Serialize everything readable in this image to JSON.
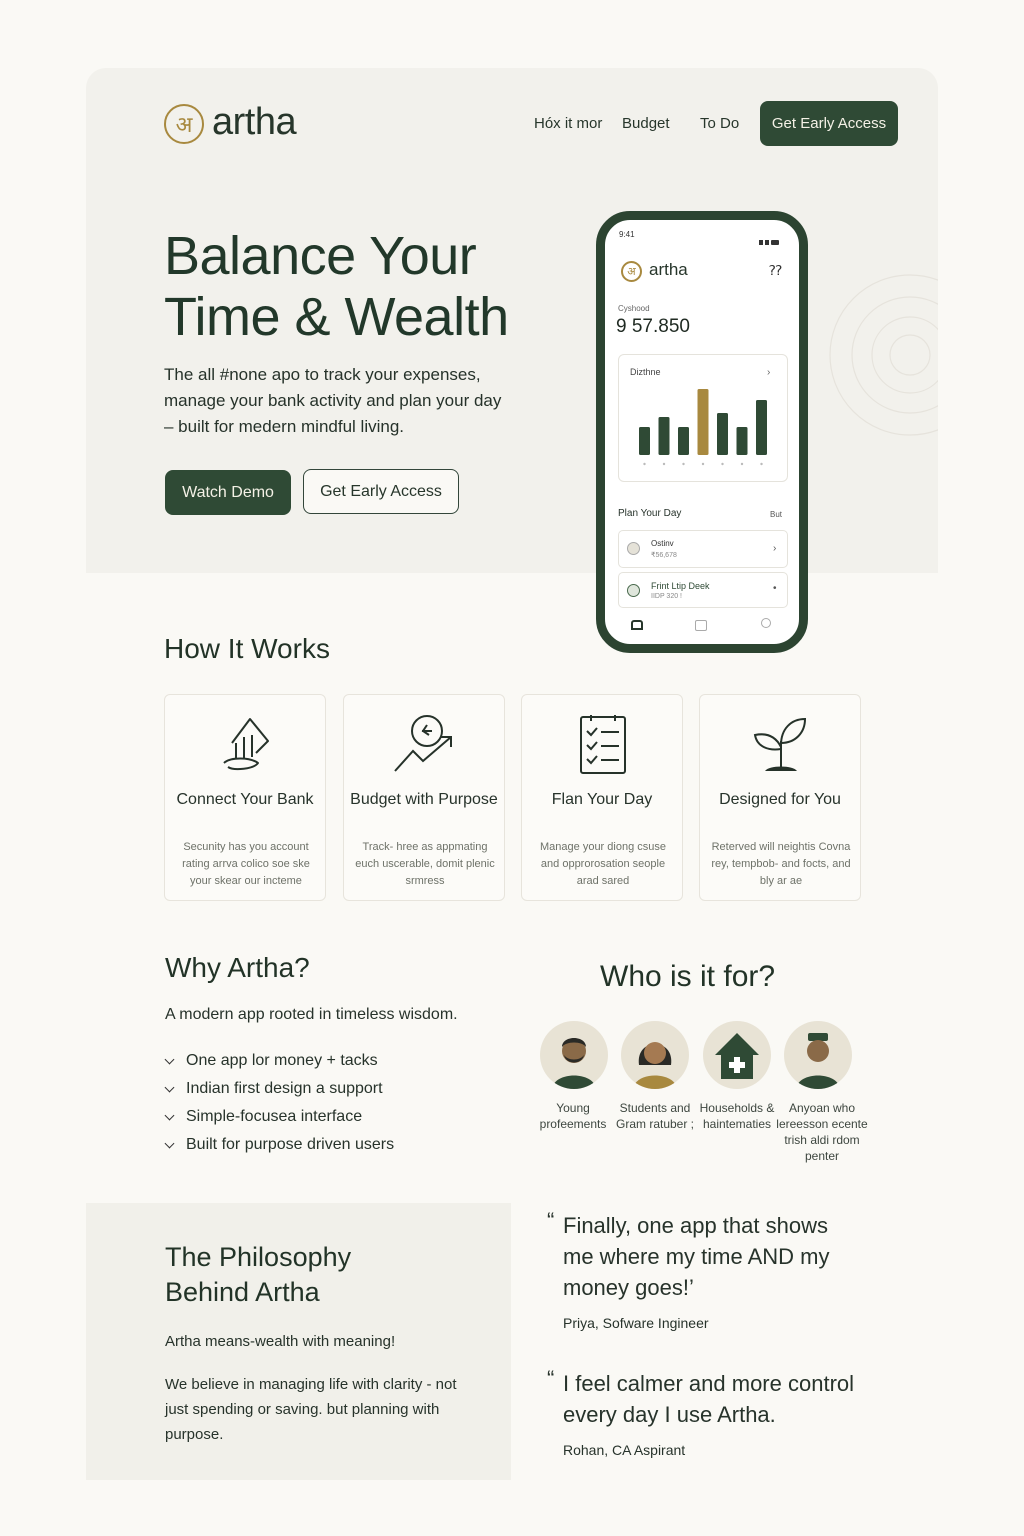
{
  "brand": {
    "name": "artha",
    "glyph": "अ"
  },
  "nav": {
    "items": [
      "Hóx it mor",
      "Budget",
      "To Do"
    ],
    "cta": "Get Early Access"
  },
  "hero": {
    "title_line1": "Balance Your",
    "title_line2": "Time & Wealth",
    "subtitle": "The all #none apo to track your expenses, manage your bank activity and plan your day – built for medern mindful living.",
    "primary_button": "Watch Demo",
    "secondary_button": "Get Early Access"
  },
  "phone": {
    "time": "9:41",
    "app_name": "artha",
    "help": "⁇",
    "balance_label": "Cyshood",
    "balance_value": "9 57.850",
    "chart_title": "Dizthne",
    "plan_title": "Plan Your Day",
    "plan_link": "But",
    "tasks": [
      {
        "title": "Ostinv",
        "sub": "₹56,678"
      },
      {
        "title": "Frint Ltip Deek",
        "sub": "IIDP 320 !"
      }
    ]
  },
  "chart_data": {
    "type": "bar",
    "categories": [
      "",
      "",
      "",
      "",
      "",
      "",
      ""
    ],
    "values": [
      28,
      38,
      28,
      66,
      42,
      28,
      55
    ],
    "highlight_index": 3,
    "colors": {
      "bar": "#2f4a35",
      "highlight": "#a8893f"
    }
  },
  "how": {
    "title": "How It Works",
    "cards": [
      {
        "icon": "bank-icon",
        "title": "Connect Your Bank",
        "desc": "Secunity has you account rating arrva colico soe ske your skear our incteme"
      },
      {
        "icon": "budget-growth-icon",
        "title": "Budget with Purpose",
        "desc": "Track- hree as appmating euch uscerable, domit plenic srmress"
      },
      {
        "icon": "checklist-icon",
        "title": "Flan Your Day",
        "desc": "Manage your diong csuse and opprorosation seople arad sared"
      },
      {
        "icon": "sprout-icon",
        "title": "Designed for You",
        "desc": "Reterved will neightis Covna rey, tempbob- and focts, and bly ar ae"
      }
    ]
  },
  "why": {
    "title": "Why Artha?",
    "subtitle": "A modern app rooted in timeless wisdom.",
    "points": [
      "One app lor money + tacks",
      "Indian first design a support",
      "Simple-focusea interface",
      "Built for purpose driven users"
    ]
  },
  "who": {
    "title": "Who is it for?",
    "audiences": [
      {
        "icon": "young-professional-avatar",
        "label": "Young profeements"
      },
      {
        "icon": "student-avatar",
        "label": "Students and Gram ratuber ;"
      },
      {
        "icon": "house-icon",
        "label": "Households & haintematies"
      },
      {
        "icon": "person-avatar",
        "label": "Anyoan who lereesson ecente trish aldi rdom penter"
      }
    ]
  },
  "philosophy": {
    "title_line1": "The Philosophy",
    "title_line2": "Behind Artha",
    "tagline": "Artha means-wealth with meaning!",
    "body": "We believe in managing life with clarity - not just spending or saving. but planning with purpose."
  },
  "testimonials": [
    {
      "quote": "Finally, one app that shows me where my time AND my money goes!’",
      "author": "Priya, Sofware Ingineer"
    },
    {
      "quote": "I feel calmer and more control every day I use Artha.",
      "author": "Rohan, CA Aspirant"
    }
  ],
  "colors": {
    "accent": "#2f4a35",
    "gold": "#a8893f",
    "background": "#faf9f5"
  }
}
